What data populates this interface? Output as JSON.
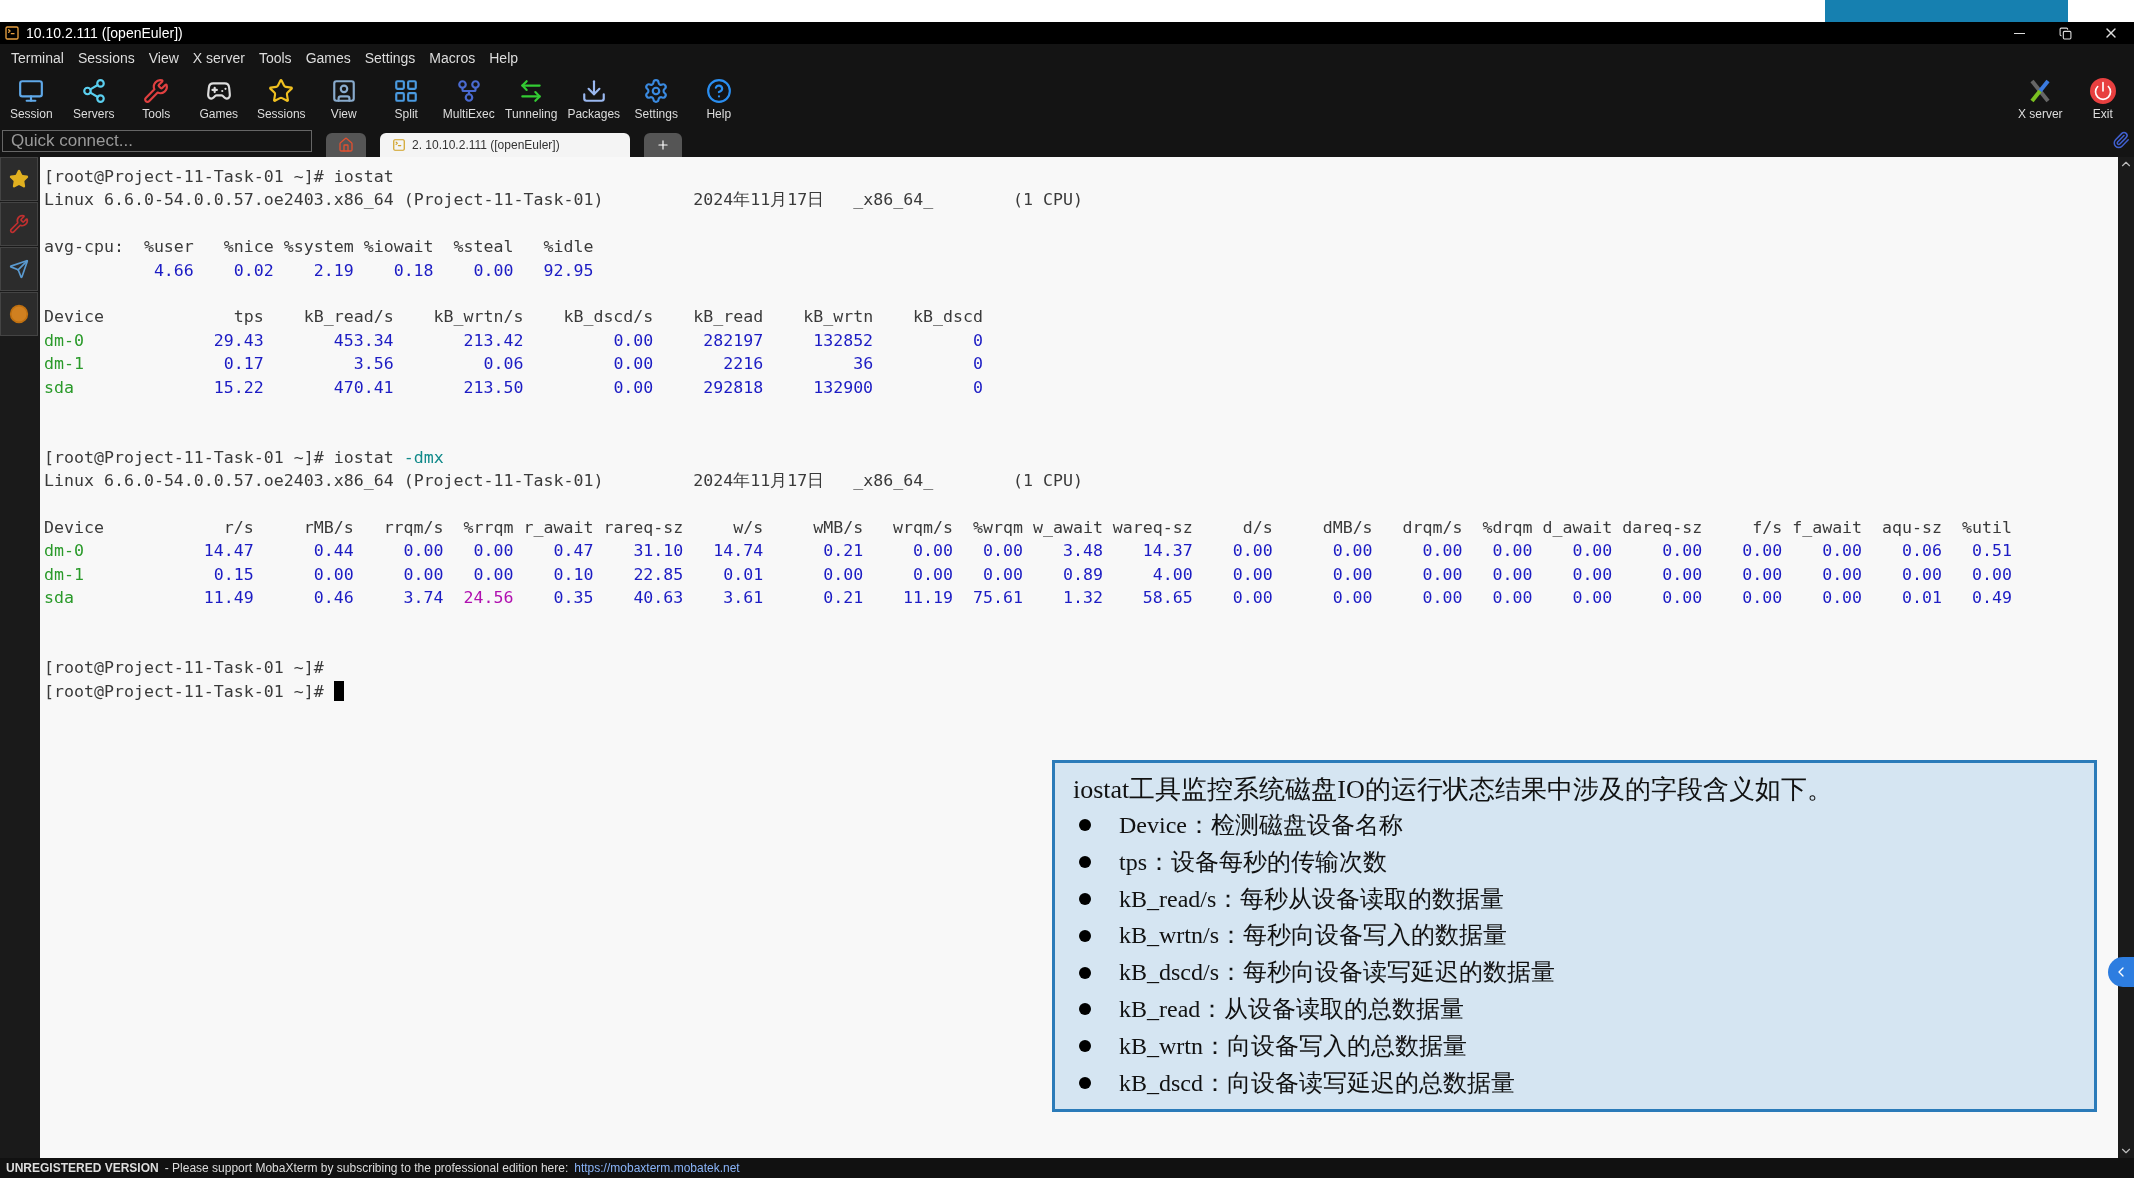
{
  "window": {
    "title": "10.10.2.111 ([openEuler])"
  },
  "menu": [
    "Terminal",
    "Sessions",
    "View",
    "X server",
    "Tools",
    "Games",
    "Settings",
    "Macros",
    "Help"
  ],
  "toolbar": [
    "Session",
    "Servers",
    "Tools",
    "Games",
    "Sessions",
    "View",
    "Split",
    "MultiExec",
    "Tunneling",
    "Packages",
    "Settings",
    "Help"
  ],
  "toolbar_right": [
    "X server",
    "Exit"
  ],
  "quick_connect": {
    "placeholder": "Quick connect..."
  },
  "tabs": [
    {
      "kind": "home",
      "selected": false
    },
    {
      "kind": "session",
      "label": "2. 10.10.2.111 ([openEuler])",
      "selected": true
    },
    {
      "kind": "new",
      "selected": false
    }
  ],
  "terminal": {
    "lines": [
      {
        "kind": "prompt",
        "prompt": "[root@Project-11-Task-01 ~]#",
        "command": "iostat",
        "cursor": false
      },
      {
        "kind": "sysinfo",
        "kernel": "Linux 6.6.0-54.0.0.57.oe2403.x86_64 (Project-11-Task-01)",
        "date": "2024年11月17日",
        "arch": "_x86_64_",
        "cpus": "(1 CPU)"
      },
      {
        "kind": "blank"
      },
      {
        "kind": "cpu_table",
        "columns": [
          "avg-cpu:",
          "%user",
          "%nice",
          "%system",
          "%iowait",
          "%steal",
          "%idle"
        ],
        "rows": [
          {
            "values": [
              "4.66",
              "0.02",
              "2.19",
              "0.18",
              "0.00",
              "92.95"
            ]
          }
        ]
      },
      {
        "kind": "blank"
      },
      {
        "kind": "device_table",
        "columns": [
          "Device",
          "tps",
          "kB_read/s",
          "kB_wrtn/s",
          "kB_dscd/s",
          "kB_read",
          "kB_wrtn",
          "kB_dscd"
        ],
        "rows": [
          {
            "device": "dm-0",
            "values": [
              "29.43",
              "453.34",
              "213.42",
              "0.00",
              "282197",
              "132852",
              "0"
            ]
          },
          {
            "device": "dm-1",
            "values": [
              "0.17",
              "3.56",
              "0.06",
              "0.00",
              "2216",
              "36",
              "0"
            ]
          },
          {
            "device": "sda",
            "values": [
              "15.22",
              "470.41",
              "213.50",
              "0.00",
              "292818",
              "132900",
              "0"
            ]
          }
        ]
      },
      {
        "kind": "blank"
      },
      {
        "kind": "blank"
      },
      {
        "kind": "prompt",
        "prompt": "[root@Project-11-Task-01 ~]#",
        "command": "iostat",
        "option": "-dmx",
        "cursor": false
      },
      {
        "kind": "sysinfo",
        "kernel": "Linux 6.6.0-54.0.0.57.oe2403.x86_64 (Project-11-Task-01)",
        "date": "2024年11月17日",
        "arch": "_x86_64_",
        "cpus": "(1 CPU)"
      },
      {
        "kind": "blank"
      },
      {
        "kind": "extended_table",
        "columns": [
          "Device",
          "r/s",
          "rMB/s",
          "rrqm/s",
          "%rrqm",
          "r_await",
          "rareq-sz",
          "w/s",
          "wMB/s",
          "wrqm/s",
          "%wrqm",
          "w_await",
          "wareq-sz",
          "d/s",
          "dMB/s",
          "drqm/s",
          "%drqm",
          "d_await",
          "dareq-sz",
          "f/s",
          "f_await",
          "aqu-sz",
          "%util"
        ],
        "rows": [
          {
            "device": "dm-0",
            "values": [
              "14.47",
              "0.44",
              "0.00",
              "0.00",
              "0.47",
              "31.10",
              "14.74",
              "0.21",
              "0.00",
              "0.00",
              "3.48",
              "14.37",
              "0.00",
              "0.00",
              "0.00",
              "0.00",
              "0.00",
              "0.00",
              "0.00",
              "0.00",
              "0.06",
              "0.51"
            ]
          },
          {
            "device": "dm-1",
            "values": [
              "0.15",
              "0.00",
              "0.00",
              "0.00",
              "0.10",
              "22.85",
              "0.01",
              "0.00",
              "0.00",
              "0.00",
              "0.89",
              "4.00",
              "0.00",
              "0.00",
              "0.00",
              "0.00",
              "0.00",
              "0.00",
              "0.00",
              "0.00",
              "0.00",
              "0.00"
            ]
          },
          {
            "device": "sda",
            "values": [
              "11.49",
              "0.46",
              "3.74",
              "24.56",
              "0.35",
              "40.63",
              "3.61",
              "0.21",
              "11.19",
              "75.61",
              "1.32",
              "58.65",
              "0.00",
              "0.00",
              "0.00",
              "0.00",
              "0.00",
              "0.00",
              "0.00",
              "0.00",
              "0.01",
              "0.49"
            ],
            "flagged": [
              false,
              false,
              false,
              true,
              false,
              false,
              false,
              false,
              false,
              false,
              false,
              false,
              false,
              false,
              false,
              false,
              false,
              false,
              false,
              false,
              false,
              false
            ]
          }
        ]
      },
      {
        "kind": "blank"
      },
      {
        "kind": "blank"
      },
      {
        "kind": "prompt",
        "prompt": "[root@Project-11-Task-01 ~]#",
        "cursor": false
      },
      {
        "kind": "prompt",
        "prompt": "[root@Project-11-Task-01 ~]#",
        "cursor": true
      }
    ]
  },
  "note": {
    "title": "iostat工具监控系统磁盘IO的运行状态结果中涉及的字段含义如下。",
    "items": [
      "Device：检测磁盘设备名称",
      "tps：设备每秒的传输次数",
      "kB_read/s：每秒从设备读取的数据量",
      "kB_wrtn/s：每秒向设备写入的数据量",
      "kB_dscd/s：每秒向设备读写延迟的数据量",
      "kB_read：从设备读取的总数据量",
      "kB_wrtn：向设备写入的总数据量",
      "kB_dscd：向设备读写延迟的总数据量"
    ]
  },
  "status_bar": {
    "badge": "UNREGISTERED VERSION",
    "message": "- Please support MobaXterm by subscribing to the professional edition here:",
    "link": "https://mobaxterm.mobatek.net"
  }
}
